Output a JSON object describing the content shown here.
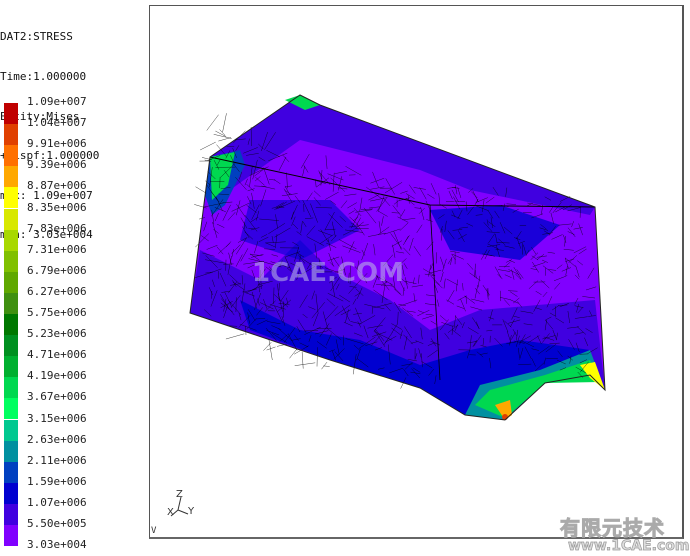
{
  "header": {
    "lines": [
      "DAT2:STRESS",
      "Time:1.000000",
      "Entity:Mises",
      "+Dispf:1.000000",
      "max: 1.09e+007",
      "min: 3.03e+004"
    ]
  },
  "legend": {
    "labels": [
      "1.09e+007",
      "1.04e+007",
      "9.91e+006",
      "9.39e+006",
      "8.87e+006",
      "8.35e+006",
      "7.83e+006",
      "7.31e+006",
      "6.79e+006",
      "6.27e+006",
      "5.75e+006",
      "5.23e+006",
      "4.71e+006",
      "4.19e+006",
      "3.67e+006",
      "3.15e+006",
      "2.63e+006",
      "2.11e+006",
      "1.59e+006",
      "1.07e+006",
      "5.50e+005",
      "3.03e+004"
    ],
    "colors": [
      "#c00000",
      "#e04000",
      "#ff7000",
      "#ffa800",
      "#ffff00",
      "#d8e800",
      "#a8d800",
      "#80c000",
      "#60a800",
      "#409010",
      "#007800",
      "#009020",
      "#00b030",
      "#00d850",
      "#00ff60",
      "#00c890",
      "#0090a0",
      "#0040c0",
      "#0000d0",
      "#4000e0",
      "#8000ff"
    ]
  },
  "viewport": {
    "axis": {
      "z": "Z",
      "x": "X",
      "y": "Y"
    },
    "view_label": "V",
    "center_watermark": "1CAE.COM"
  },
  "watermark": {
    "line1": "有限元技术",
    "line2": "www.1CAE.com"
  }
}
